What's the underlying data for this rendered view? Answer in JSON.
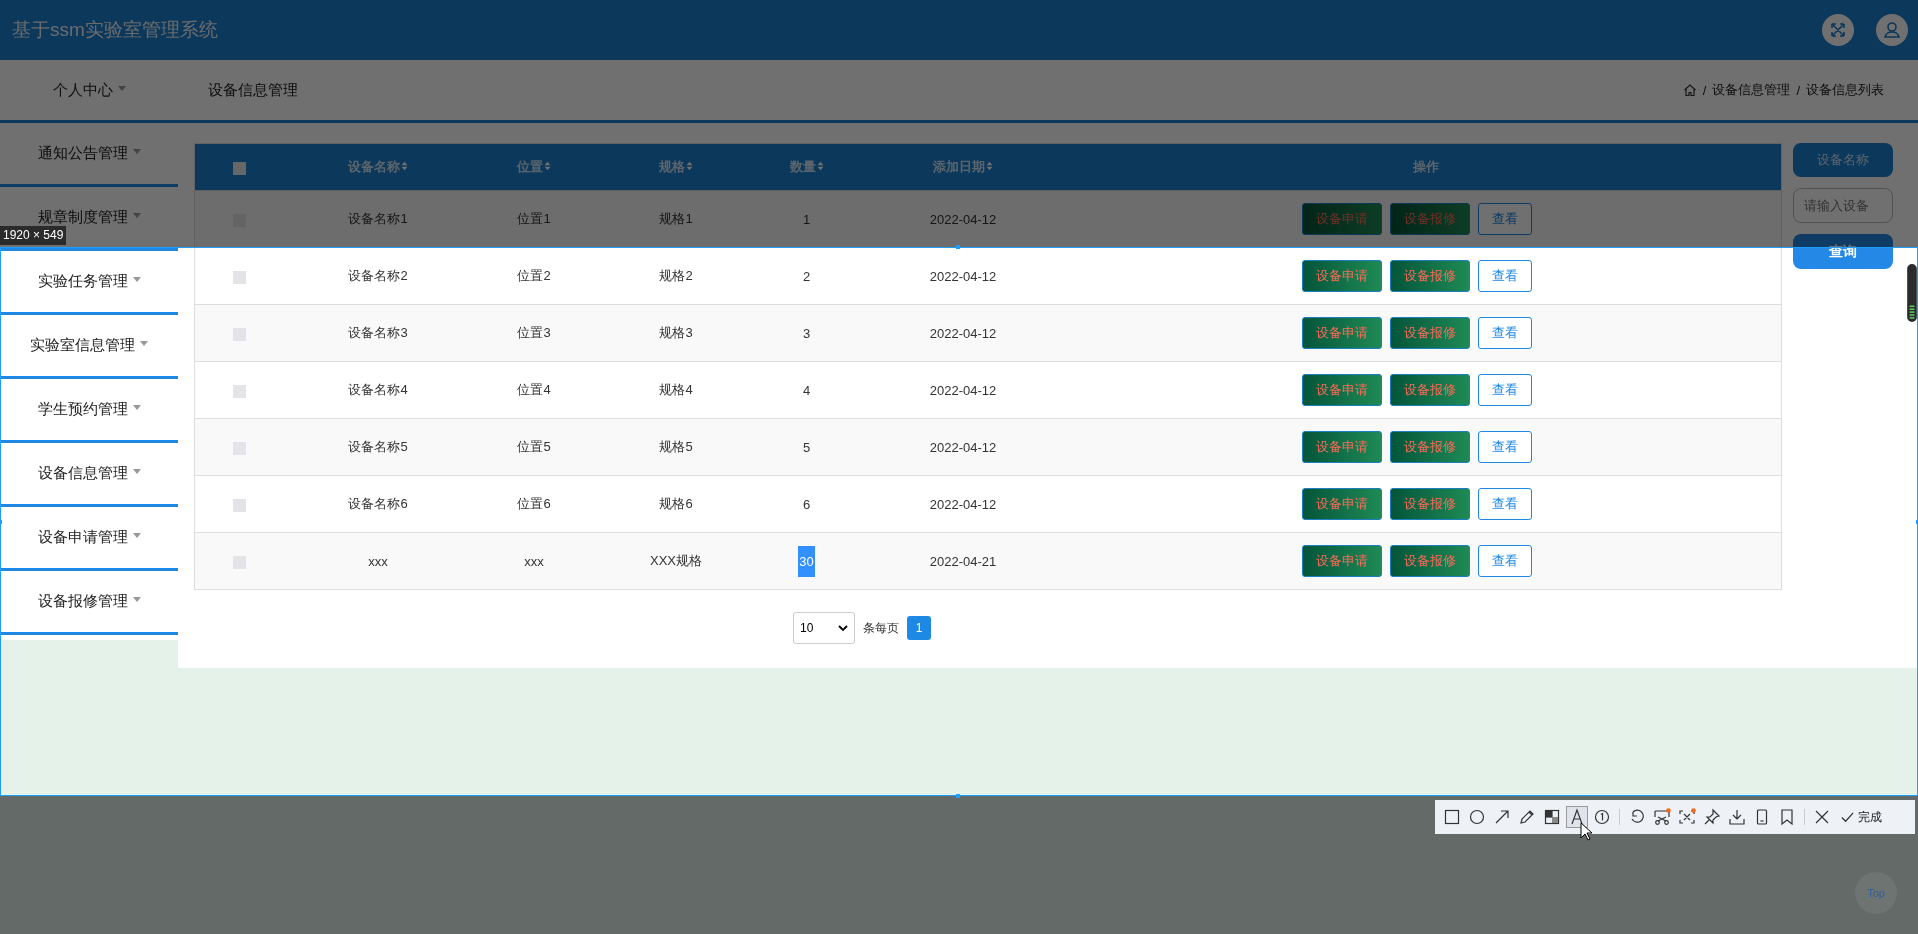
{
  "header": {
    "title": "基于ssm实验室管理系统"
  },
  "nav": {
    "menu_label": "个人中心",
    "page_title": "设备信息管理",
    "breadcrumb": [
      "设备信息管理",
      "设备信息列表"
    ],
    "separator": "/"
  },
  "sidebar": {
    "items": [
      "通知公告管理",
      "规章制度管理",
      "实验任务管理",
      "实验室信息管理",
      "学生预约管理",
      "设备信息管理",
      "设备申请管理",
      "设备报修管理"
    ]
  },
  "table": {
    "all_checked": false,
    "columns": [
      {
        "label": "设备名称",
        "sortable": true
      },
      {
        "label": "位置",
        "sortable": true
      },
      {
        "label": "规格",
        "sortable": true
      },
      {
        "label": "数量",
        "sortable": true
      },
      {
        "label": "添加日期",
        "sortable": true
      },
      {
        "label": "操作",
        "sortable": false
      }
    ],
    "rows": [
      {
        "checked": false,
        "name": "设备名称1",
        "location": "位置1",
        "spec": "规格1",
        "quantity": "1",
        "quantity_highlighted": false,
        "date": "2022-04-12",
        "actions": [
          "设备申请",
          "设备报修",
          "查看"
        ]
      },
      {
        "checked": false,
        "name": "设备名称2",
        "location": "位置2",
        "spec": "规格2",
        "quantity": "2",
        "quantity_highlighted": false,
        "date": "2022-04-12",
        "actions": [
          "设备申请",
          "设备报修",
          "查看"
        ]
      },
      {
        "checked": false,
        "name": "设备名称3",
        "location": "位置3",
        "spec": "规格3",
        "quantity": "3",
        "quantity_highlighted": false,
        "date": "2022-04-12",
        "actions": [
          "设备申请",
          "设备报修",
          "查看"
        ]
      },
      {
        "checked": false,
        "name": "设备名称4",
        "location": "位置4",
        "spec": "规格4",
        "quantity": "4",
        "quantity_highlighted": false,
        "date": "2022-04-12",
        "actions": [
          "设备申请",
          "设备报修",
          "查看"
        ]
      },
      {
        "checked": false,
        "name": "设备名称5",
        "location": "位置5",
        "spec": "规格5",
        "quantity": "5",
        "quantity_highlighted": false,
        "date": "2022-04-12",
        "actions": [
          "设备申请",
          "设备报修",
          "查看"
        ]
      },
      {
        "checked": false,
        "name": "设备名称6",
        "location": "位置6",
        "spec": "规格6",
        "quantity": "6",
        "quantity_highlighted": false,
        "date": "2022-04-12",
        "actions": [
          "设备申请",
          "设备报修",
          "查看"
        ]
      },
      {
        "checked": false,
        "name": "xxx",
        "location": "xxx",
        "spec": "XXX规格",
        "quantity": "30",
        "quantity_highlighted": true,
        "date": "2022-04-21",
        "actions": [
          "设备申请",
          "设备报修",
          "查看"
        ]
      }
    ]
  },
  "pagination": {
    "page_size": "10",
    "unit": "条每页",
    "pages": [
      {
        "label": "1",
        "selected": true
      }
    ]
  },
  "search": {
    "label": "设备名称",
    "placeholder": "请输入设备",
    "button": "查询"
  },
  "capture": {
    "size_label": "1920 × 549",
    "done_label": "完成",
    "tool_groups": [
      [
        {
          "kind": "rectangle",
          "selected": false,
          "dot": false
        },
        {
          "kind": "ellipse",
          "selected": false,
          "dot": false
        },
        {
          "kind": "arrow",
          "selected": false,
          "dot": false
        },
        {
          "kind": "pencil",
          "selected": false,
          "dot": false
        },
        {
          "kind": "mosaic",
          "selected": false,
          "dot": false
        },
        {
          "kind": "text",
          "selected": true,
          "dot": false
        },
        {
          "kind": "number",
          "selected": false,
          "dot": false
        }
      ],
      [
        {
          "kind": "undo",
          "selected": false,
          "dot": false
        },
        {
          "kind": "scissors",
          "selected": false,
          "dot": true
        },
        {
          "kind": "scan",
          "selected": false,
          "dot": true
        },
        {
          "kind": "pin",
          "selected": false,
          "dot": false
        },
        {
          "kind": "download",
          "selected": false,
          "dot": false
        },
        {
          "kind": "phone",
          "selected": false,
          "dot": false
        },
        {
          "kind": "bookmark",
          "selected": false,
          "dot": false
        }
      ],
      [
        {
          "kind": "close",
          "selected": false,
          "dot": false
        }
      ]
    ]
  },
  "back_to_top": "Top"
}
